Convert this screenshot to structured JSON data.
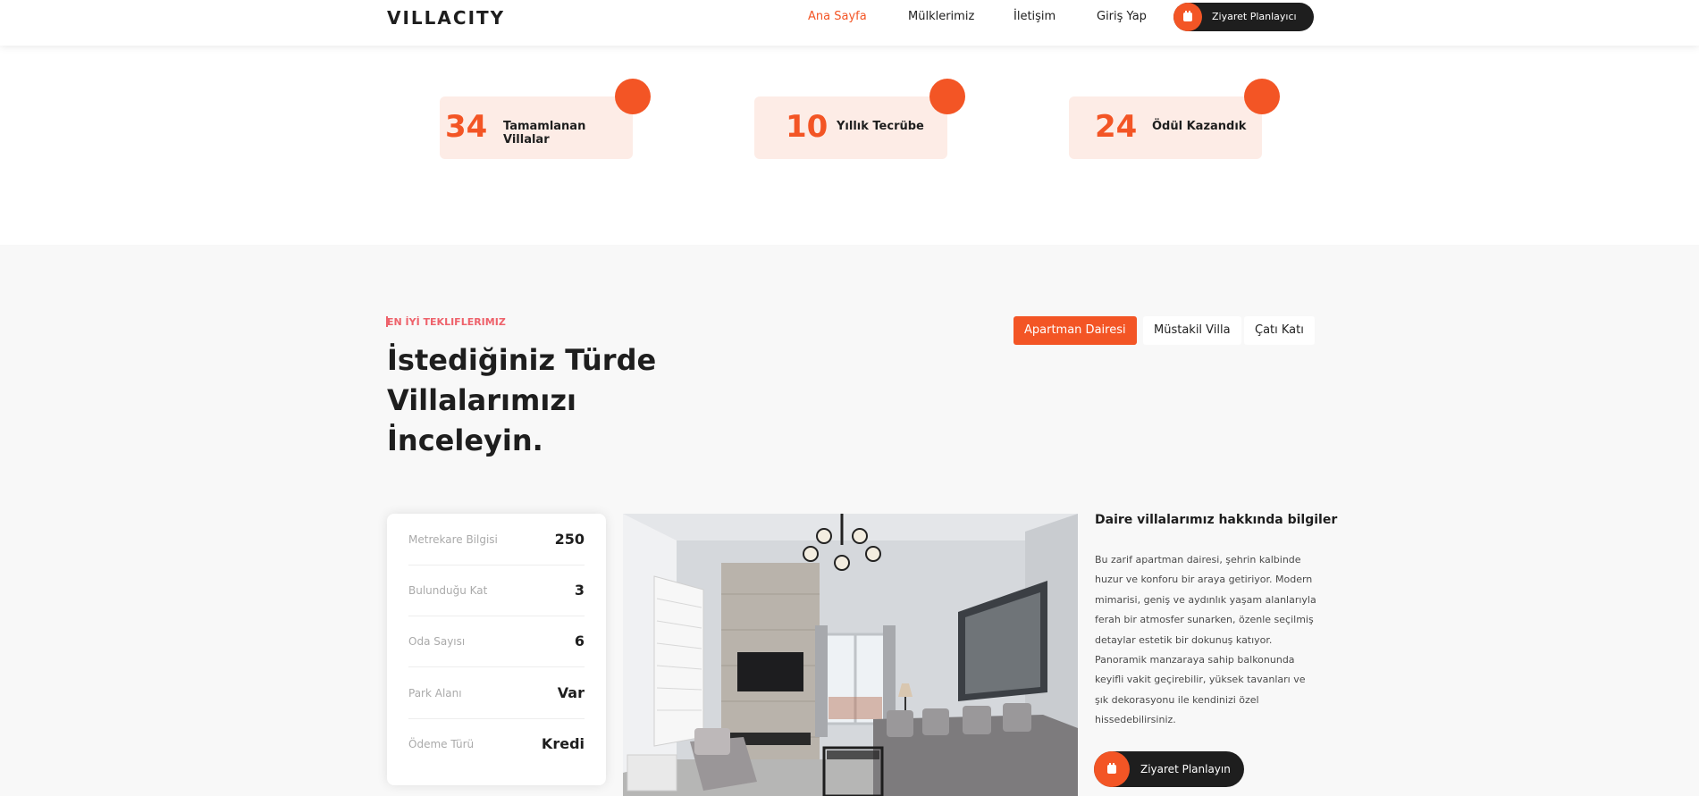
{
  "header": {
    "logo": "VILLACITY",
    "nav": [
      "Ana Sayfa",
      "Mülklerimiz",
      "İletişim",
      "Giriş Yap"
    ],
    "cta": "Ziyaret Planlayıcı"
  },
  "counters": [
    {
      "number": "34",
      "label": "Tamamlanan Villalar"
    },
    {
      "number": "10",
      "label": "Yıllık Tecrübe"
    },
    {
      "number": "24",
      "label": "Ödül Kazandık"
    }
  ],
  "offers": {
    "eyebrow": "EN İYİ TEKLIFLERIMIZ",
    "heading": "İstediğiniz Türde Villalarımızı İnceleyin.",
    "tabs": [
      "Apartman Dairesi",
      "Müstakil Villa",
      "Çatı Katı"
    ],
    "info": [
      {
        "label": "Metrekare Bilgisi",
        "value": "250"
      },
      {
        "label": "Bulunduğu Kat",
        "value": "3"
      },
      {
        "label": "Oda Sayısı",
        "value": "6"
      },
      {
        "label": "Park Alanı",
        "value": "Var"
      },
      {
        "label": "Ödeme Türü",
        "value": "Kredi"
      }
    ],
    "desc_title": "Daire villalarımız hakkında bilgiler",
    "desc_text": "Bu zarif apartman dairesi, şehrin kalbinde huzur ve konforu bir araya getiriyor. Modern mimarisi, geniş ve aydınlık yaşam alanlarıyla ferah bir atmosfer sunarken, özenle seçilmiş detaylar estetik bir dokunuş katıyor. Panoramik manzaraya sahip balkonunda keyifli vakit geçirebilir, yüksek tavanları ve şık dekorasyonu ile kendinizi özel hissedebilirsiniz.",
    "cta": "Ziyaret Planlayın"
  },
  "colors": {
    "accent": "#f35525",
    "dark": "#1e1e1e",
    "eyebrow": "#ee626b",
    "counter_bg": "#fdece6"
  },
  "icons": [
    "calendar-icon"
  ]
}
